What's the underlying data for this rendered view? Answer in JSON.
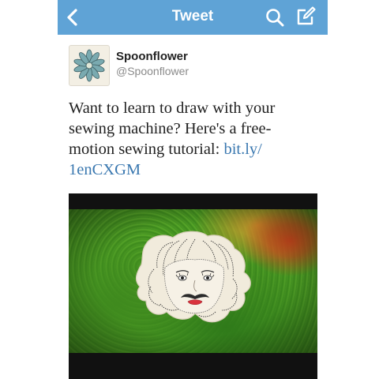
{
  "navbar": {
    "title": "Tweet",
    "back_icon": "chevron-left-icon",
    "search_icon": "search-icon",
    "compose_icon": "compose-icon",
    "color": "#5fa3d6"
  },
  "tweet": {
    "author_name": "Spoonflower",
    "author_handle": "@Spoonflower",
    "text_before": "Want to learn to draw with your sewing machine? Here's a free-motion sewing tutorial: ",
    "link_text": "bit.ly/\n1enCXGM",
    "link_color": "#3a78b0"
  },
  "media": {
    "icon": "embroidered-face-photo"
  }
}
